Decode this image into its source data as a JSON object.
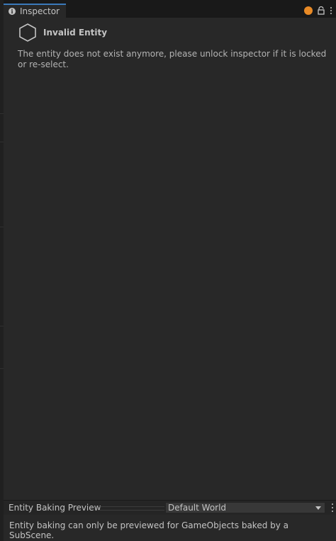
{
  "window": {
    "tab_label": "Inspector"
  },
  "entity": {
    "title": "Invalid Entity",
    "message": "The entity does not exist anymore, please unlock inspector if it is locked or re-select."
  },
  "preview": {
    "title": "Entity Baking Preview",
    "world_selected": "Default World",
    "message": "Entity baking can only be previewed for GameObjects baked by a SubScene."
  },
  "colors": {
    "accent": "#3a79bb",
    "status_dot": "#e88a26",
    "panel_bg": "#282828"
  },
  "icons": [
    "info-icon",
    "status-dot-icon",
    "lock-icon",
    "kebab-menu-icon",
    "hexagon-entity-icon",
    "chevron-down-icon"
  ]
}
